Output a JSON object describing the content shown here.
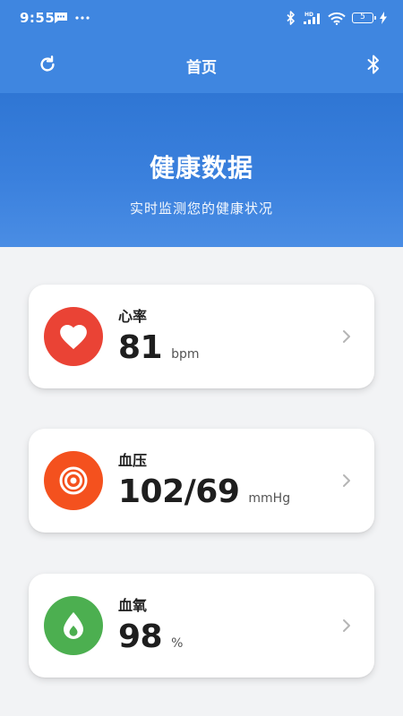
{
  "status_bar": {
    "time": "9:55",
    "battery": "5"
  },
  "app_bar": {
    "title": "首页"
  },
  "hero": {
    "title": "健康数据",
    "subtitle": "实时监测您的健康状况"
  },
  "metrics": [
    {
      "label": "心率",
      "value": "81",
      "unit": "bpm",
      "color": "#ea4335",
      "icon": "heart-icon"
    },
    {
      "label": "血压",
      "value": "102/69",
      "unit": "mmHg",
      "color": "#f4511e",
      "icon": "target-icon"
    },
    {
      "label": "血氧",
      "value": "98",
      "unit": "%",
      "color": "#4caf50",
      "icon": "drop-icon"
    }
  ],
  "colors": {
    "primary": "#3f86e0",
    "background": "#f2f3f5"
  }
}
